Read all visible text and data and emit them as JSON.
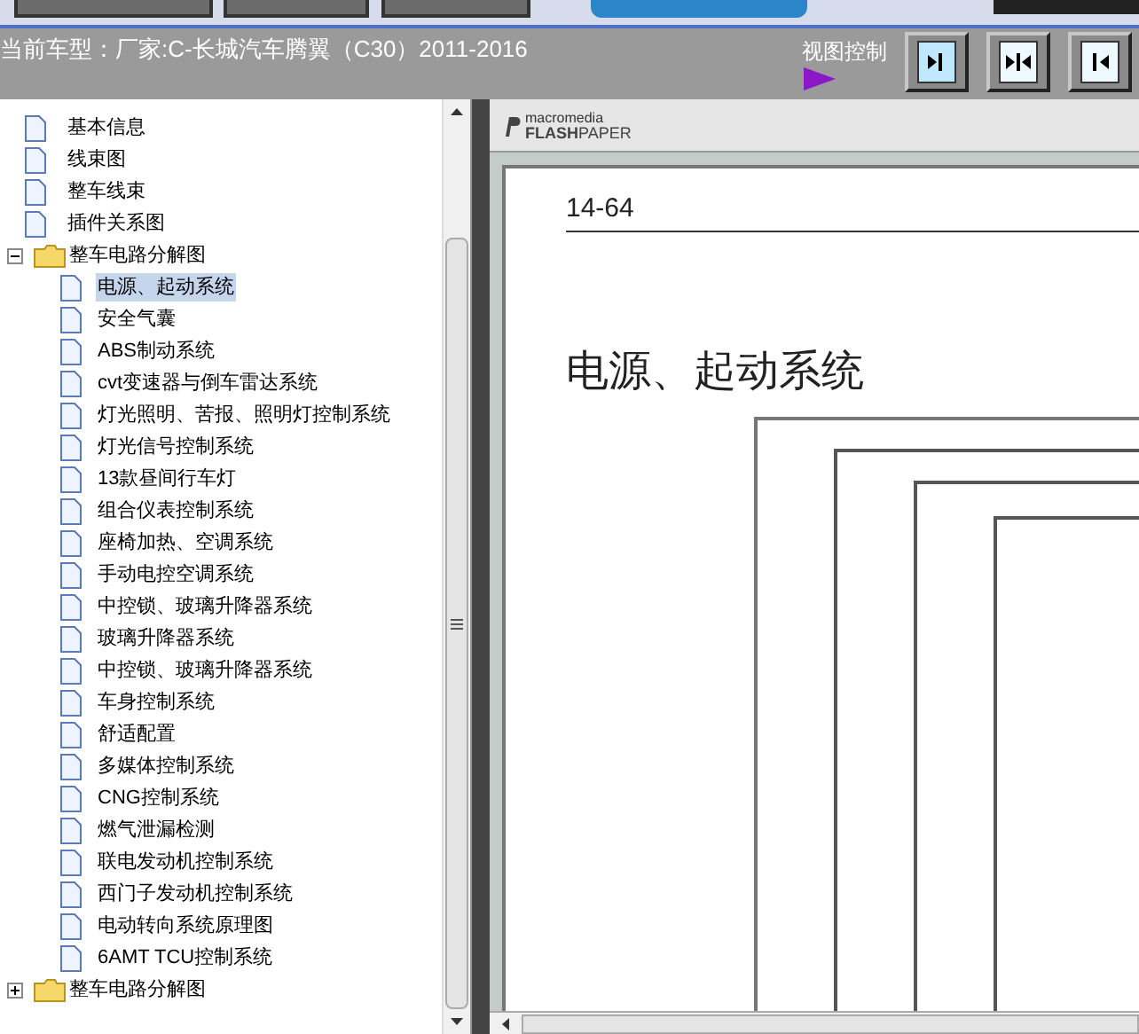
{
  "header": {
    "current_model": "当前车型：厂家:C-长城汽车腾翼（C30）2011-2016",
    "view_control_label": "视图控制"
  },
  "view_buttons": [
    {
      "kind": "right",
      "selected": true
    },
    {
      "kind": "both",
      "selected": false
    },
    {
      "kind": "left",
      "selected": false
    }
  ],
  "tree": [
    {
      "label": "基本信息",
      "kind": "page"
    },
    {
      "label": "线束图",
      "kind": "page"
    },
    {
      "label": "整车线束",
      "kind": "page"
    },
    {
      "label": "插件关系图",
      "kind": "page"
    },
    {
      "label": "整车电路分解图",
      "kind": "folder",
      "expanded": true,
      "children": [
        {
          "label": "电源、起动系统",
          "selected": true
        },
        {
          "label": "安全气囊",
          "selected": false
        },
        {
          "label": "ABS制动系统",
          "selected": false
        },
        {
          "label": "cvt变速器与倒车雷达系统",
          "selected": false
        },
        {
          "label": "灯光照明、苦报、照明灯控制系统",
          "selected": false
        },
        {
          "label": "灯光信号控制系统",
          "selected": false
        },
        {
          "label": "13款昼间行车灯",
          "selected": false
        },
        {
          "label": "组合仪表控制系统",
          "selected": false
        },
        {
          "label": "座椅加热、空调系统",
          "selected": false
        },
        {
          "label": "手动电控空调系统",
          "selected": false
        },
        {
          "label": "中控锁、玻璃升降器系统",
          "selected": false
        },
        {
          "label": "玻璃升降器系统",
          "selected": false
        },
        {
          "label": "中控锁、玻璃升降器系统",
          "selected": false
        },
        {
          "label": "车身控制系统",
          "selected": false
        },
        {
          "label": "舒适配置",
          "selected": false
        },
        {
          "label": "多媒体控制系统",
          "selected": false
        },
        {
          "label": "CNG控制系统",
          "selected": false
        },
        {
          "label": "燃气泄漏检测",
          "selected": false
        },
        {
          "label": "联电发动机控制系统",
          "selected": false
        },
        {
          "label": "西门子发动机控制系统",
          "selected": false
        },
        {
          "label": "电动转向系统原理图",
          "selected": false
        },
        {
          "label": "6AMT TCU控制系统",
          "selected": false
        }
      ]
    },
    {
      "label": "整车电路分解图",
      "kind": "folder",
      "expanded": false
    }
  ],
  "viewer": {
    "logo_top": "macromedia",
    "logo_bold": "FLASH",
    "logo_rest": "PAPER",
    "page_number": "14-64",
    "page_title": "电源、起动系统"
  }
}
